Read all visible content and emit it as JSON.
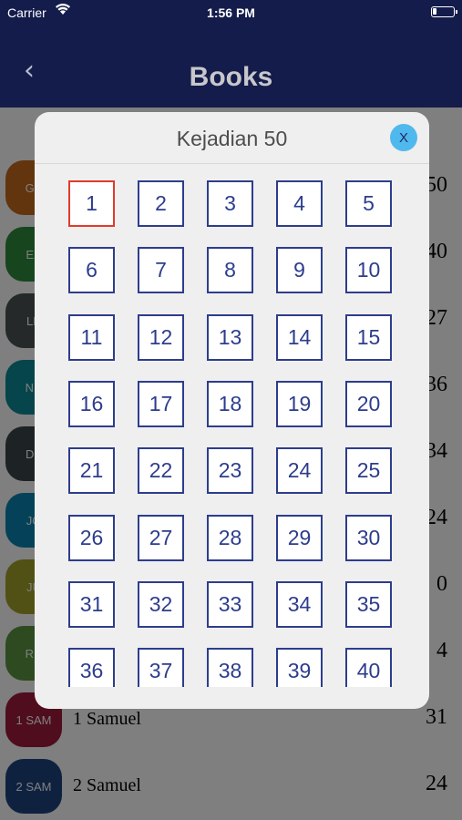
{
  "status": {
    "carrier": "Carrier",
    "time": "1:56 PM"
  },
  "nav": {
    "back": "‹",
    "title": "Books"
  },
  "books": [
    {
      "code": "GE",
      "name": "",
      "count": "50",
      "color": "#c46a1c"
    },
    {
      "code": "EX",
      "name": "",
      "count": "40",
      "color": "#2f8a3d"
    },
    {
      "code": "LE",
      "name": "",
      "count": "27",
      "color": "#4a5354"
    },
    {
      "code": "NU",
      "name": "",
      "count": "36",
      "color": "#0b8a96"
    },
    {
      "code": "DE",
      "name": "",
      "count": "34",
      "color": "#3b4449"
    },
    {
      "code": "JO",
      "name": "",
      "count": "24",
      "color": "#0b85b2"
    },
    {
      "code": "JU",
      "name": "",
      "count": "0",
      "color": "#a3a32a"
    },
    {
      "code": "RU",
      "name": "",
      "count": "4",
      "color": "#5a9440"
    },
    {
      "code": "1 SAM",
      "name": "1 Samuel",
      "count": "31",
      "color": "#a01a3a"
    },
    {
      "code": "2 SAM",
      "name": "2 Samuel",
      "count": "24",
      "color": "#1c4480"
    }
  ],
  "modal": {
    "title": "Kejadian 50",
    "close_label": "X",
    "selected": "1",
    "chapters": [
      "1",
      "2",
      "3",
      "4",
      "5",
      "6",
      "7",
      "8",
      "9",
      "10",
      "11",
      "12",
      "13",
      "14",
      "15",
      "16",
      "17",
      "18",
      "19",
      "20",
      "21",
      "22",
      "23",
      "24",
      "25",
      "26",
      "27",
      "28",
      "29",
      "30",
      "31",
      "32",
      "33",
      "34",
      "35",
      "36",
      "37",
      "38",
      "39",
      "40"
    ]
  },
  "colors": {
    "nav": "#141c4b",
    "cell_border": "#2d3d8c",
    "selected_border": "#e23a2a",
    "close_bg": "#4fb9ee"
  }
}
